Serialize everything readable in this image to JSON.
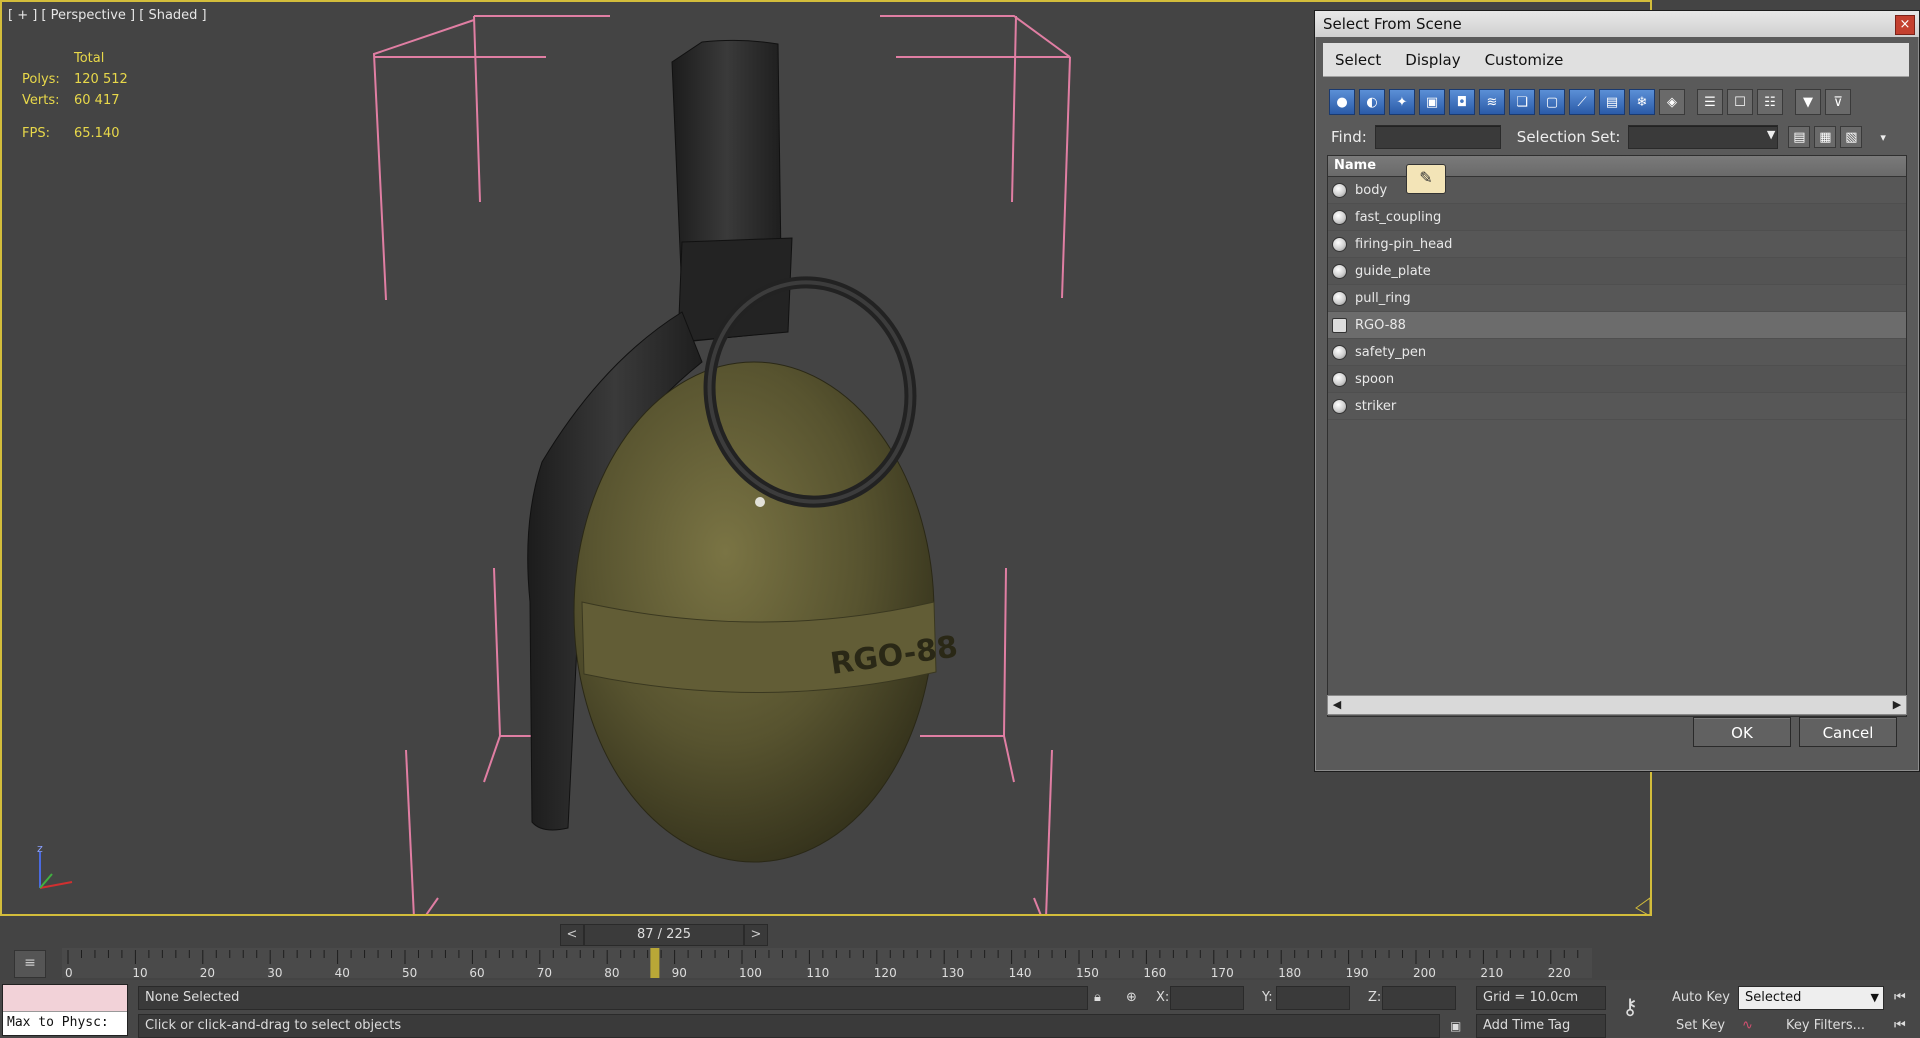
{
  "viewport": {
    "label": "[ + ] [ Perspective ] [ Shaded ]",
    "stats_header": "Total",
    "stats": [
      {
        "key": "Polys:",
        "value": "120 512"
      },
      {
        "key": "Verts:",
        "value": "60 417"
      }
    ],
    "fps_label": "FPS:",
    "fps_value": "65.140",
    "model_text": "RGO-88",
    "axis_label": "z"
  },
  "dialog": {
    "title": "Select From Scene",
    "close_glyph": "×",
    "menu": [
      "Select",
      "Display",
      "Customize"
    ],
    "find_label": "Find:",
    "find_value": "",
    "selection_set_label": "Selection Set:",
    "selection_set_value": "",
    "column_header": "Name",
    "items": [
      {
        "name": "body",
        "selected": false,
        "type": "object"
      },
      {
        "name": "fast_coupling",
        "selected": false,
        "type": "object"
      },
      {
        "name": "firing-pin_head",
        "selected": false,
        "type": "object"
      },
      {
        "name": "guide_plate",
        "selected": false,
        "type": "object"
      },
      {
        "name": "pull_ring",
        "selected": false,
        "type": "object"
      },
      {
        "name": "RGO-88",
        "selected": true,
        "type": "group"
      },
      {
        "name": "safety_pen",
        "selected": false,
        "type": "object"
      },
      {
        "name": "spoon",
        "selected": false,
        "type": "object"
      },
      {
        "name": "striker",
        "selected": false,
        "type": "object"
      }
    ],
    "ok_label": "OK",
    "cancel_label": "Cancel"
  },
  "timeline": {
    "prev": "<",
    "next": ">",
    "counter": "87 / 225",
    "current_frame": 87,
    "total_frames": 225,
    "ticks": [
      "0",
      "10",
      "20",
      "30",
      "40",
      "50",
      "60",
      "70",
      "80",
      "90",
      "100",
      "110",
      "120",
      "130",
      "140",
      "150",
      "160",
      "170",
      "180",
      "190",
      "200",
      "210",
      "220"
    ]
  },
  "status": {
    "script_listener": "Max to Physc:",
    "selection": "None Selected",
    "prompt": "Click or click-and-drag to select objects",
    "x_label": "X:",
    "y_label": "Y:",
    "z_label": "Z:",
    "grid": "Grid = 10.0cm",
    "add_time_tag": "Add Time Tag",
    "auto_key": "Auto Key",
    "auto_key_mode": "Selected",
    "set_key": "Set Key",
    "key_filters": "Key Filters..."
  },
  "colors": {
    "viewport_border": "#d3bd3b",
    "stats_text": "#e8d84a",
    "bounding_box": "#e07ea3",
    "grenade_body": "#57532f"
  }
}
